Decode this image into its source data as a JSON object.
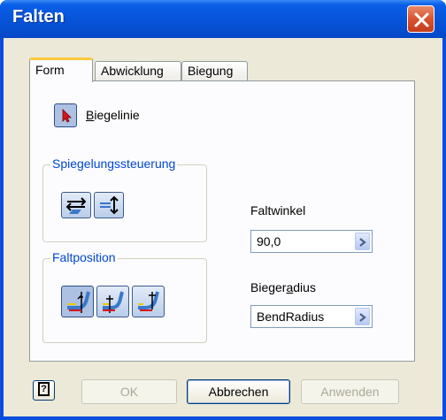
{
  "window": {
    "title": "Falten"
  },
  "tabs": [
    {
      "label": "Form",
      "active": true
    },
    {
      "label": "Abwicklung",
      "active": false
    },
    {
      "label": "Biegung",
      "active": false
    }
  ],
  "bend_line": {
    "label": "Biegelinie",
    "icon": "select-arrow-icon"
  },
  "mirror_control": {
    "legend": "Spiegelungssteuerung",
    "buttons": [
      "flip-side-icon",
      "flip-direction-icon"
    ]
  },
  "fold_angle": {
    "label": "Faltwinkel",
    "value": "90,0"
  },
  "fold_position": {
    "legend": "Faltposition",
    "buttons": [
      "bend-start-icon",
      "bend-centerline-icon",
      "bend-end-icon"
    ],
    "selected": 0
  },
  "bend_radius": {
    "label_pre": "Bieger",
    "label_accel": "a",
    "label_post": "dius",
    "value": "BendRadius"
  },
  "footer": {
    "ok": "OK",
    "cancel": "Abbrechen",
    "apply": "Anwenden"
  },
  "colors": {
    "titlebar": "#0a4ddf",
    "accent": "#0046d5",
    "tab_highlight": "#ffc83c"
  }
}
